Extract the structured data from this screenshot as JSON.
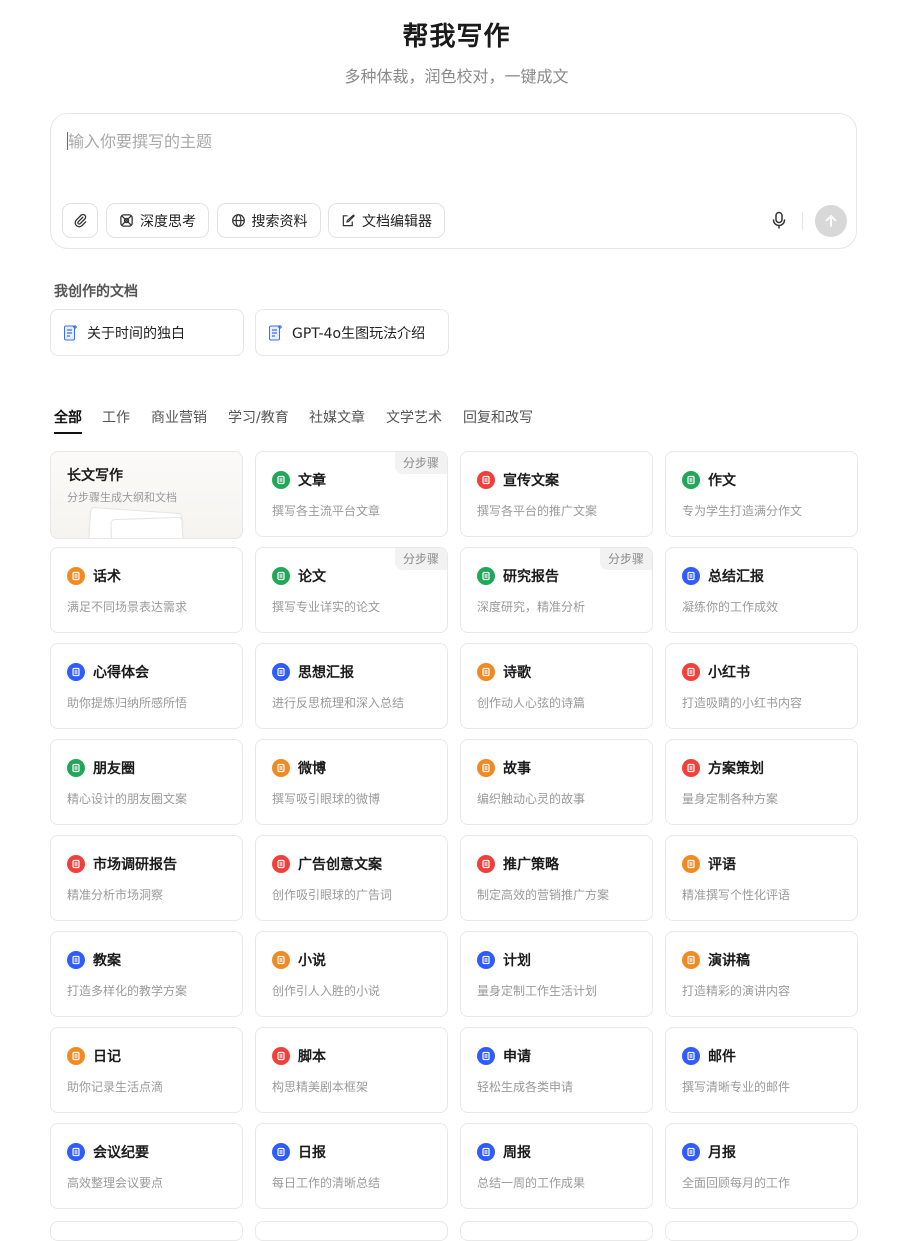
{
  "header": {
    "title": "帮我写作",
    "subtitle": "多种体裁，润色校对，一键成文"
  },
  "composer": {
    "placeholder": "输入你要撰写的主题",
    "tools": [
      {
        "label": "深度思考",
        "icon": "deep-think-icon"
      },
      {
        "label": "搜索资料",
        "icon": "globe-icon"
      },
      {
        "label": "文档编辑器",
        "icon": "doc-edit-icon"
      }
    ],
    "attach_icon": "paperclip-icon",
    "mic_icon": "microphone-icon",
    "send_icon": "arrow-up-icon"
  },
  "my_docs": {
    "label": "我创作的文档",
    "items": [
      {
        "title": "关于时间的独白"
      },
      {
        "title": "GPT-4o生图玩法介绍"
      }
    ]
  },
  "tabs": [
    "全部",
    "工作",
    "商业营销",
    "学习/教育",
    "社媒文章",
    "文学艺术",
    "回复和改写"
  ],
  "active_tab": "全部",
  "badge_text": "分步骤",
  "cards": [
    {
      "title": "长文写作",
      "desc": "分步骤生成大纲和文档"
    },
    {
      "title": "文章",
      "desc": "撰写各主流平台文章",
      "color": "#22a65a",
      "badge": true
    },
    {
      "title": "宣传文案",
      "desc": "撰写各平台的推广文案",
      "color": "#f0403c"
    },
    {
      "title": "作文",
      "desc": "专为学生打造满分作文",
      "color": "#22a65a"
    },
    {
      "title": "话术",
      "desc": "满足不同场景表达需求",
      "color": "#f08a24"
    },
    {
      "title": "论文",
      "desc": "撰写专业详实的论文",
      "color": "#22a65a",
      "badge": true
    },
    {
      "title": "研究报告",
      "desc": "深度研究，精准分析",
      "color": "#22a65a",
      "badge": true
    },
    {
      "title": "总结汇报",
      "desc": "凝练你的工作成效",
      "color": "#2f5cff"
    },
    {
      "title": "心得体会",
      "desc": "助你提炼归纳所感所悟",
      "color": "#2f5cff"
    },
    {
      "title": "思想汇报",
      "desc": "进行反思梳理和深入总结",
      "color": "#2f5cff"
    },
    {
      "title": "诗歌",
      "desc": "创作动人心弦的诗篇",
      "color": "#f08a24"
    },
    {
      "title": "小红书",
      "desc": "打造吸睛的小红书内容",
      "color": "#f0403c"
    },
    {
      "title": "朋友圈",
      "desc": "精心设计的朋友圈文案",
      "color": "#22a65a"
    },
    {
      "title": "微博",
      "desc": "撰写吸引眼球的微博",
      "color": "#f08a24"
    },
    {
      "title": "故事",
      "desc": "编织触动心灵的故事",
      "color": "#f08a24"
    },
    {
      "title": "方案策划",
      "desc": "量身定制各种方案",
      "color": "#f0403c"
    },
    {
      "title": "市场调研报告",
      "desc": "精准分析市场洞察",
      "color": "#f0403c"
    },
    {
      "title": "广告创意文案",
      "desc": "创作吸引眼球的广告词",
      "color": "#f0403c"
    },
    {
      "title": "推广策略",
      "desc": "制定高效的营销推广方案",
      "color": "#f0403c"
    },
    {
      "title": "评语",
      "desc": "精准撰写个性化评语",
      "color": "#f08a24"
    },
    {
      "title": "教案",
      "desc": "打造多样化的教学方案",
      "color": "#2f5cff"
    },
    {
      "title": "小说",
      "desc": "创作引人入胜的小说",
      "color": "#f08a24"
    },
    {
      "title": "计划",
      "desc": "量身定制工作生活计划",
      "color": "#2f5cff"
    },
    {
      "title": "演讲稿",
      "desc": "打造精彩的演讲内容",
      "color": "#f08a24"
    },
    {
      "title": "日记",
      "desc": "助你记录生活点滴",
      "color": "#f08a24"
    },
    {
      "title": "脚本",
      "desc": "构思精美剧本框架",
      "color": "#f0403c"
    },
    {
      "title": "申请",
      "desc": "轻松生成各类申请",
      "color": "#2f5cff"
    },
    {
      "title": "邮件",
      "desc": "撰写清晰专业的邮件",
      "color": "#2f5cff"
    },
    {
      "title": "会议纪要",
      "desc": "高效整理会议要点",
      "color": "#2f5cff"
    },
    {
      "title": "日报",
      "desc": "每日工作的清晰总结",
      "color": "#2f5cff"
    },
    {
      "title": "周报",
      "desc": "总结一周的工作成果",
      "color": "#2f5cff"
    },
    {
      "title": "月报",
      "desc": "全面回顾每月的工作",
      "color": "#2f5cff"
    }
  ]
}
